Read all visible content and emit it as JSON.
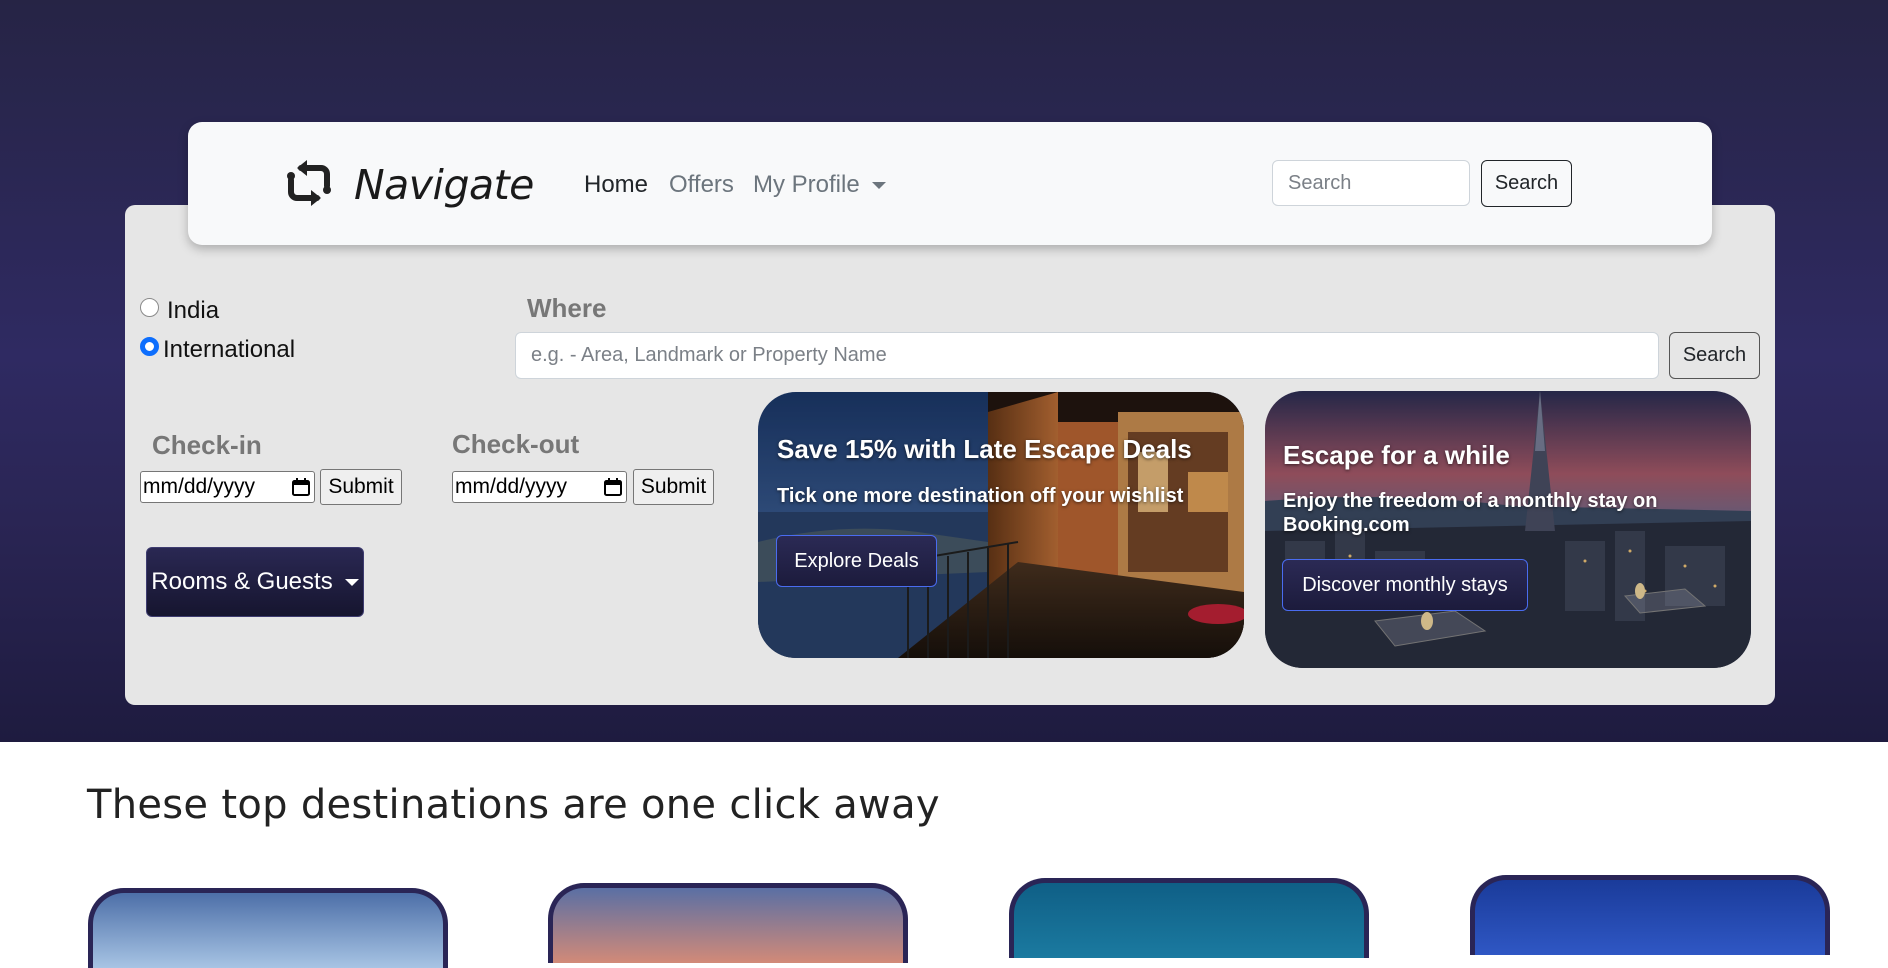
{
  "navbar": {
    "brand": "Navigate",
    "links": [
      {
        "label": "Home"
      },
      {
        "label": "Offers"
      },
      {
        "label": "My Profile"
      }
    ],
    "search_placeholder": "Search",
    "search_button": "Search"
  },
  "booking": {
    "region_options": [
      {
        "label": "India",
        "checked": false
      },
      {
        "label": "International",
        "checked": true
      }
    ],
    "where_label": "Where",
    "where_placeholder": "e.g. - Area, Landmark or Property Name",
    "where_button": "Search",
    "checkin_label": "Check-in",
    "checkout_label": "Check-out",
    "date_placeholder": "mm/dd/yyyy",
    "submit_label": "Submit",
    "rooms_button": "Rooms & Guests"
  },
  "cards": [
    {
      "title": "Save 15% with Late Escape Deals",
      "subtitle": "Tick one more destination off your wishlist",
      "button": "Explore Deals"
    },
    {
      "title": "Escape for a while",
      "subtitle": "Enjoy the freedom of a monthly stay on Booking.com",
      "button": "Discover monthly stays"
    }
  ],
  "destinations": {
    "heading": "These top destinations are one click away"
  },
  "colors": {
    "hero_background": "#2f2a62",
    "panel_background": "#e6e6e6",
    "navbar_background": "#f8f9fa",
    "radio_accent": "#0d6efd",
    "button_dark": "#1c1b3c"
  }
}
